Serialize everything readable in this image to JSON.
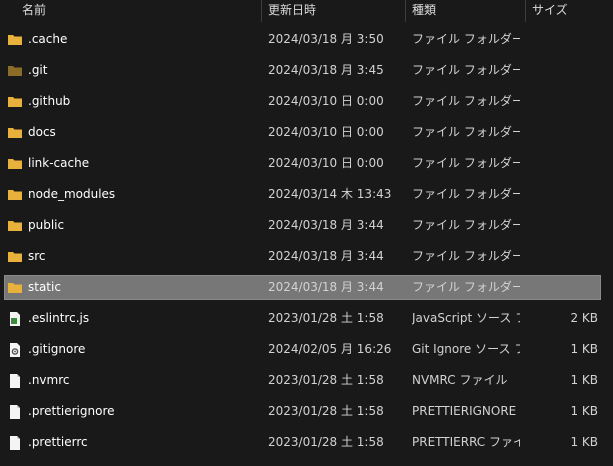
{
  "header": {
    "name_label": "名前",
    "date_label": "更新日時",
    "type_label": "種類",
    "size_label": "サイズ",
    "sort_glyph": "^"
  },
  "colors": {
    "folder": "#e8b13c",
    "folder_dim": "#8c6d28",
    "selection": "#777777"
  },
  "rows": [
    {
      "name": ".cache",
      "date": "2024/03/18 月 3:50",
      "type": "ファイル フォルダー",
      "size": "",
      "icon": "folder-icon"
    },
    {
      "name": ".git",
      "date": "2024/03/18 月 3:45",
      "type": "ファイル フォルダー",
      "size": "",
      "icon": "folder-dim-icon"
    },
    {
      "name": ".github",
      "date": "2024/03/10 日 0:00",
      "type": "ファイル フォルダー",
      "size": "",
      "icon": "folder-icon"
    },
    {
      "name": "docs",
      "date": "2024/03/10 日 0:00",
      "type": "ファイル フォルダー",
      "size": "",
      "icon": "folder-icon"
    },
    {
      "name": "link-cache",
      "date": "2024/03/10 日 0:00",
      "type": "ファイル フォルダー",
      "size": "",
      "icon": "folder-icon"
    },
    {
      "name": "node_modules",
      "date": "2024/03/14 木 13:43",
      "type": "ファイル フォルダー",
      "size": "",
      "icon": "folder-icon"
    },
    {
      "name": "public",
      "date": "2024/03/18 月 3:44",
      "type": "ファイル フォルダー",
      "size": "",
      "icon": "folder-icon"
    },
    {
      "name": "src",
      "date": "2024/03/18 月 3:44",
      "type": "ファイル フォルダー",
      "size": "",
      "icon": "folder-icon"
    },
    {
      "name": "static",
      "date": "2024/03/18 月 3:44",
      "type": "ファイル フォルダー",
      "size": "",
      "icon": "folder-icon",
      "selected": true
    },
    {
      "name": ".eslintrc.js",
      "date": "2023/01/28 土 1:58",
      "type": "JavaScript ソース フ...",
      "size": "2 KB",
      "icon": "js-file-icon"
    },
    {
      "name": ".gitignore",
      "date": "2024/02/05 月 16:26",
      "type": "Git Ignore ソース フ...",
      "size": "1 KB",
      "icon": "config-file-icon"
    },
    {
      "name": ".nvmrc",
      "date": "2023/01/28 土 1:58",
      "type": "NVMRC ファイル",
      "size": "1 KB",
      "icon": "file-icon"
    },
    {
      "name": ".prettierignore",
      "date": "2023/01/28 土 1:58",
      "type": "PRETTIERIGNORE ...",
      "size": "1 KB",
      "icon": "file-icon"
    },
    {
      "name": ".prettierrc",
      "date": "2023/01/28 土 1:58",
      "type": "PRETTIERRC ファイル",
      "size": "1 KB",
      "icon": "file-icon"
    }
  ]
}
